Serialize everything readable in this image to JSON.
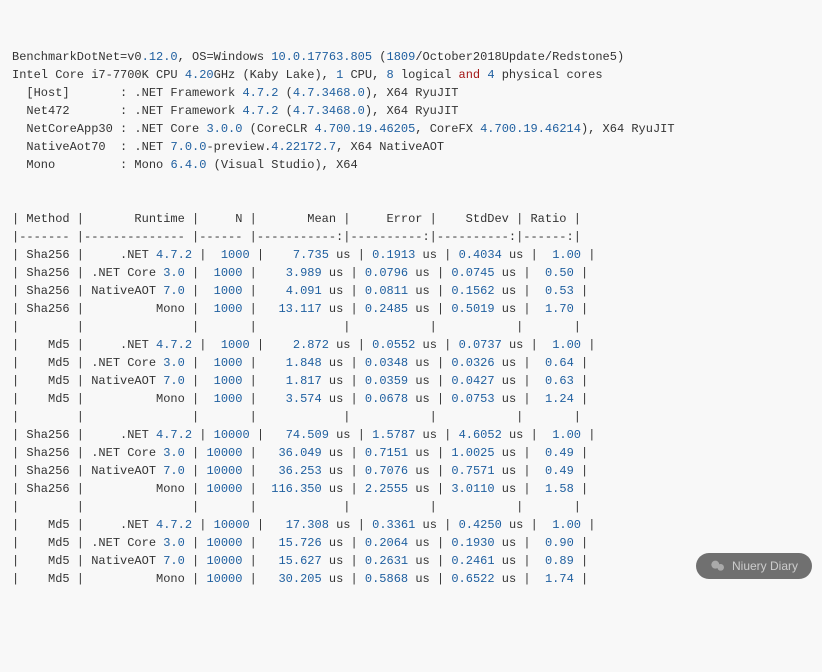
{
  "header": {
    "line1_a": "BenchmarkDotNet=v0",
    "line1_b": ".12.0",
    "line1_c": ", OS=Windows ",
    "line1_d": "10.0.17763.805",
    "line1_e": " (",
    "line1_f": "1809",
    "line1_g": "/October2018Update/Redstone5)",
    "line2_a": "Intel Core i7-7700K CPU ",
    "line2_b": "4.20",
    "line2_c": "GHz (Kaby Lake), ",
    "line2_d": "1",
    "line2_e": " CPU, ",
    "line2_f": "8",
    "line2_g": " logical ",
    "line2_h": "and",
    "line2_i": " ",
    "line2_j": "4",
    "line2_k": " physical cores",
    "line3_a": "  [Host]       : .NET Framework ",
    "line3_b": "4.7.2",
    "line3_c": " (",
    "line3_d": "4.7.3468.0",
    "line3_e": "), X64 RyuJIT",
    "line4_a": "  Net472       : .NET Framework ",
    "line4_b": "4.7.2",
    "line4_c": " (",
    "line4_d": "4.7.3468.0",
    "line4_e": "), X64 RyuJIT",
    "line5_a": "  NetCoreApp30 : .NET Core ",
    "line5_b": "3.0.0",
    "line5_c": " (CoreCLR ",
    "line5_d": "4.700.19.46205",
    "line5_e": ", CoreFX ",
    "line5_f": "4.700.19.46214",
    "line5_g": "), X64 RyuJIT",
    "line6_a": "  NativeAot70  : .NET ",
    "line6_b": "7.0.0",
    "line6_c": "-preview.",
    "line6_d": "4.22172.7",
    "line6_e": ", X64 NativeAOT",
    "line7_a": "  Mono         : Mono ",
    "line7_b": "6.4.0",
    "line7_c": " (Visual Studio), X64"
  },
  "table": {
    "hdr": "| Method |       Runtime |     N |       Mean |     Error |    StdDev | Ratio |",
    "sep": "|------- |-------------- |------ |-----------:|----------:|----------:|------:|",
    "emptyrow": "|        |               |       |            |           |           |       |",
    "rows": [
      {
        "method": "Sha256",
        "runtime_a": "    .NET ",
        "runtime_b": "4.7.2",
        "n": "1000",
        "mean": "7.735",
        "mean_pad": "   ",
        "error": "0.1913",
        "stddev": "0.4034",
        "ratio": "1.00"
      },
      {
        "method": "Sha256",
        "runtime_a": ".NET Core ",
        "runtime_b": "3.0",
        "n": "1000",
        "mean": "3.989",
        "mean_pad": "   ",
        "error": "0.0796",
        "stddev": "0.0745",
        "ratio": "0.50"
      },
      {
        "method": "Sha256",
        "runtime_a": "NativeAOT ",
        "runtime_b": "7.0",
        "n": "1000",
        "mean": "4.091",
        "mean_pad": "   ",
        "error": "0.0811",
        "stddev": "0.1562",
        "ratio": "0.53"
      },
      {
        "method": "Sha256",
        "runtime_a": "         Mono",
        "runtime_b": "",
        "n": "1000",
        "mean": "13.117",
        "mean_pad": "  ",
        "error": "0.2485",
        "stddev": "0.5019",
        "ratio": "1.70"
      }
    ],
    "rows2": [
      {
        "method": "   Md5",
        "runtime_a": "    .NET ",
        "runtime_b": "4.7.2",
        "n": "1000",
        "mean": "2.872",
        "mean_pad": "   ",
        "error": "0.0552",
        "stddev": "0.0737",
        "ratio": "1.00"
      },
      {
        "method": "   Md5",
        "runtime_a": ".NET Core ",
        "runtime_b": "3.0",
        "n": "1000",
        "mean": "1.848",
        "mean_pad": "   ",
        "error": "0.0348",
        "stddev": "0.0326",
        "ratio": "0.64"
      },
      {
        "method": "   Md5",
        "runtime_a": "NativeAOT ",
        "runtime_b": "7.0",
        "n": "1000",
        "mean": "1.817",
        "mean_pad": "   ",
        "error": "0.0359",
        "stddev": "0.0427",
        "ratio": "0.63"
      },
      {
        "method": "   Md5",
        "runtime_a": "         Mono",
        "runtime_b": "",
        "n": "1000",
        "mean": "3.574",
        "mean_pad": "   ",
        "error": "0.0678",
        "stddev": "0.0753",
        "ratio": "1.24"
      }
    ],
    "rows3": [
      {
        "method": "Sha256",
        "runtime_a": "    .NET ",
        "runtime_b": "4.7.2",
        "n": "10000",
        "mean": "74.509",
        "mean_pad": "  ",
        "error": "1.5787",
        "stddev": "4.6052",
        "ratio": "1.00"
      },
      {
        "method": "Sha256",
        "runtime_a": ".NET Core ",
        "runtime_b": "3.0",
        "n": "10000",
        "mean": "36.049",
        "mean_pad": "  ",
        "error": "0.7151",
        "stddev": "1.0025",
        "ratio": "0.49"
      },
      {
        "method": "Sha256",
        "runtime_a": "NativeAOT ",
        "runtime_b": "7.0",
        "n": "10000",
        "mean": "36.253",
        "mean_pad": "  ",
        "error": "0.7076",
        "stddev": "0.7571",
        "ratio": "0.49"
      },
      {
        "method": "Sha256",
        "runtime_a": "         Mono",
        "runtime_b": "",
        "n": "10000",
        "mean": "116.350",
        "mean_pad": " ",
        "error": "2.2555",
        "stddev": "3.0110",
        "ratio": "1.58"
      }
    ],
    "rows4": [
      {
        "method": "   Md5",
        "runtime_a": "    .NET ",
        "runtime_b": "4.7.2",
        "n": "10000",
        "mean": "17.308",
        "mean_pad": "  ",
        "error": "0.3361",
        "stddev": "0.4250",
        "ratio": "1.00"
      },
      {
        "method": "   Md5",
        "runtime_a": ".NET Core ",
        "runtime_b": "3.0",
        "n": "10000",
        "mean": "15.726",
        "mean_pad": "  ",
        "error": "0.2064",
        "stddev": "0.1930",
        "ratio": "0.90"
      },
      {
        "method": "   Md5",
        "runtime_a": "NativeAOT ",
        "runtime_b": "7.0",
        "n": "10000",
        "mean": "15.627",
        "mean_pad": "  ",
        "error": "0.2631",
        "stddev": "0.2461",
        "ratio": "0.89"
      },
      {
        "method": "   Md5",
        "runtime_a": "         Mono",
        "runtime_b": "",
        "n": "10000",
        "mean": "30.205",
        "mean_pad": "  ",
        "error": "0.5868",
        "stddev": "0.6522",
        "ratio": "1.74"
      }
    ],
    "us": " us"
  },
  "watermark": "Niuery Diary"
}
